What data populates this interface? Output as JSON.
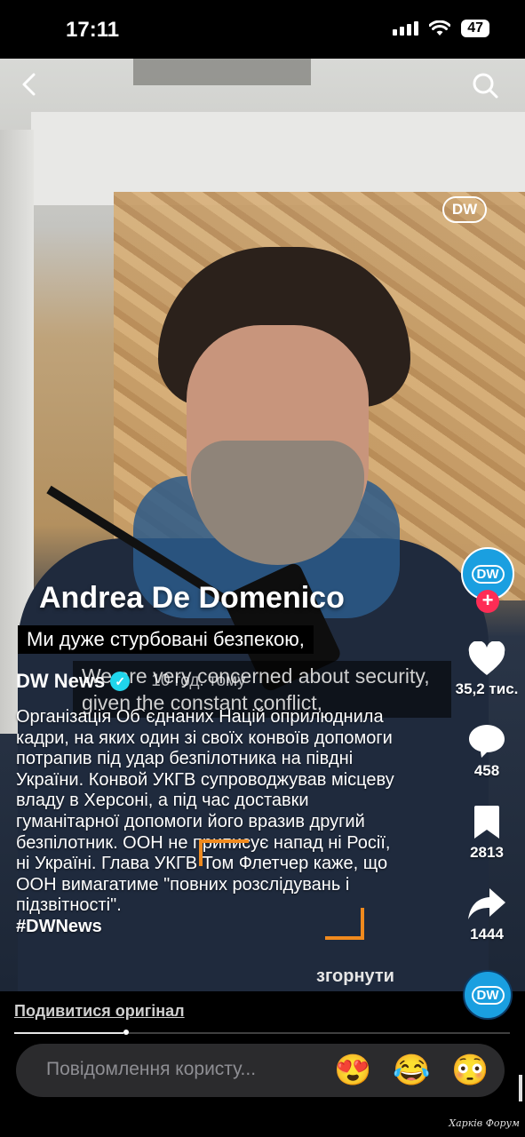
{
  "status_bar": {
    "time": "17:11",
    "battery": "47"
  },
  "video": {
    "watermark": "DW",
    "speaker_name": "Andrea De Domenico",
    "caption_ua": "Ми дуже стурбовані безпекою,",
    "caption_en": "We are very concerned about security, given the constant conflict,"
  },
  "post": {
    "author": "DW News",
    "time_ago": "10 год. тому",
    "description": "Організація Об`єднаних Націй оприлюднила кадри, на яких один зі своїх конвоїв допомоги потрапив під удар безпілотника на півдні України. Конвой УКГВ супроводжував місцеву владу в Херсоні, а під час доставки гуманітарної допомоги його вразив другий безпілотник. ООН не приписує напад ні Росії, ні Україні. Глава УКГВ Том Флетчер каже, що ООН вимагатиме \"повних розслідувань і підзвітності\".",
    "hashtag": "#DWNews",
    "collapse_label": "згорнути",
    "view_original": "Подивитися оригінал",
    "progress": 0.22
  },
  "rail": {
    "avatar_label": "DW",
    "likes": "35,2 тис.",
    "comments": "458",
    "bookmarks": "2813",
    "shares": "1444"
  },
  "message": {
    "placeholder": "Повідомлення користу...",
    "emojis": [
      "😍",
      "😂",
      "😳"
    ]
  },
  "watermark_site": "Харків Форум"
}
